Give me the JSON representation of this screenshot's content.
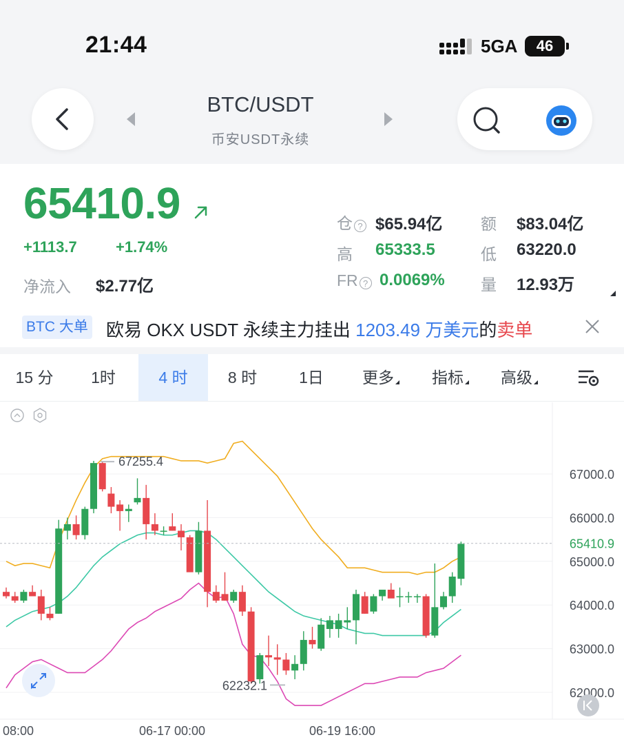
{
  "status_bar": {
    "time": "21:44",
    "network": "5GA",
    "battery": "46"
  },
  "header": {
    "pair": "BTC/USDT",
    "exchange": "币安USDT永续",
    "back_icon": "chevron-left-icon",
    "search_icon": "search-icon",
    "assistant_icon": "robot-avatar-icon"
  },
  "ticker": {
    "last_price": "65410.9",
    "change": "+1113.7",
    "change_pct": "+1.74%",
    "net_inflow_label": "净流入",
    "net_inflow_value": "$2.77亿",
    "stats": {
      "oi_label": "仓",
      "oi_value": "$65.94亿",
      "turnover_label": "额",
      "turnover_value": "$83.04亿",
      "high_label": "高",
      "high_value": "65333.5",
      "low_label": "低",
      "low_value": "63220.0",
      "fr_label": "FR",
      "fr_value": "0.0069%",
      "volume_label": "量",
      "volume_value": "12.93万"
    },
    "accent_green": "#2ea35a"
  },
  "news": {
    "tag": "BTC 大单",
    "text_prefix": "欧易 OKX USDT 永续主力挂出 ",
    "amount": "1203.49 万美元",
    "text_mid": "的",
    "side": "卖单"
  },
  "timeframes": [
    {
      "label": "15 分",
      "active": false,
      "dropdown": false
    },
    {
      "label": "1时",
      "active": false,
      "dropdown": false
    },
    {
      "label": "4 时",
      "active": true,
      "dropdown": false
    },
    {
      "label": "8 时",
      "active": false,
      "dropdown": false
    },
    {
      "label": "1日",
      "active": false,
      "dropdown": false
    },
    {
      "label": "更多",
      "active": false,
      "dropdown": true
    },
    {
      "label": "指标",
      "active": false,
      "dropdown": true
    },
    {
      "label": "高级",
      "active": false,
      "dropdown": true
    }
  ],
  "chart_data": {
    "type": "candlestick",
    "y_ticks": [
      67000,
      66000,
      65000,
      64000,
      63000,
      62000
    ],
    "y_tick_labels": [
      "67000.0",
      "66000.0",
      "65000.0",
      "64000.0",
      "63000.0",
      "62000.0"
    ],
    "ylim": [
      61600,
      67600
    ],
    "x_ticks": [
      "08:00",
      "06-17 00:00",
      "06-19 16:00"
    ],
    "current_price_label": "65410.9",
    "current_price": 65410.9,
    "max_label": "67255.4",
    "min_label": "62232.1",
    "up_color": "#2ea35a",
    "down_color": "#e7474d",
    "upper_band_color": "#f0ad1f",
    "mid_band_color": "#3cc8a5",
    "lower_band_color": "#dc48b4",
    "candles": [
      [
        64300,
        64400,
        64150,
        64200
      ],
      [
        64200,
        64300,
        64050,
        64100
      ],
      [
        64100,
        64350,
        64050,
        64300
      ],
      [
        64300,
        64450,
        64200,
        64200
      ],
      [
        64200,
        64350,
        63650,
        63800
      ],
      [
        63800,
        63950,
        63650,
        63700
      ],
      [
        63800,
        65950,
        63800,
        65750
      ],
      [
        65700,
        66000,
        65500,
        65850
      ],
      [
        65850,
        66050,
        65500,
        65600
      ],
      [
        65600,
        66250,
        65500,
        66200
      ],
      [
        66200,
        67300,
        66100,
        67250
      ],
      [
        67250,
        67300,
        66600,
        66650
      ],
      [
        66550,
        66700,
        66100,
        66250
      ],
      [
        66300,
        66400,
        65700,
        66150
      ],
      [
        66150,
        66300,
        65900,
        66200
      ],
      [
        66350,
        66900,
        66300,
        66450
      ],
      [
        66450,
        66750,
        65500,
        65850
      ],
      [
        65850,
        66100,
        65600,
        65700
      ],
      [
        65700,
        65800,
        65600,
        65700
      ],
      [
        65800,
        66100,
        65700,
        65700
      ],
      [
        65700,
        65850,
        65250,
        65550
      ],
      [
        65550,
        65600,
        64800,
        64750
      ],
      [
        64750,
        65900,
        64700,
        65700
      ],
      [
        65700,
        66400,
        63950,
        64300
      ],
      [
        64300,
        64450,
        64050,
        64100
      ],
      [
        64250,
        64750,
        64100,
        64100
      ],
      [
        64100,
        64350,
        64050,
        64300
      ],
      [
        64300,
        64450,
        63750,
        63850
      ],
      [
        63850,
        63950,
        62200,
        62250
      ],
      [
        62300,
        62900,
        62200,
        62850
      ],
      [
        62850,
        63300,
        62600,
        62800
      ],
      [
        62800,
        63100,
        62400,
        62750
      ],
      [
        62750,
        62900,
        62400,
        62500
      ],
      [
        62500,
        62850,
        62300,
        62650
      ],
      [
        62650,
        63400,
        62500,
        63200
      ],
      [
        63200,
        63500,
        63000,
        63100
      ],
      [
        63000,
        63700,
        62950,
        63550
      ],
      [
        63450,
        63750,
        63250,
        63650
      ],
      [
        63450,
        63800,
        63250,
        63650
      ],
      [
        63600,
        63950,
        63450,
        63650
      ],
      [
        63650,
        64350,
        63100,
        64250
      ],
      [
        64200,
        64300,
        63800,
        63800
      ],
      [
        63850,
        64250,
        63800,
        64200
      ],
      [
        64200,
        64350,
        64100,
        64350
      ],
      [
        64350,
        64500,
        64200,
        64150
      ],
      [
        64200,
        64400,
        63950,
        64200
      ],
      [
        64200,
        64300,
        64050,
        64200
      ],
      [
        64200,
        64250,
        64050,
        64200
      ],
      [
        64200,
        64250,
        63250,
        63300
      ],
      [
        63300,
        64950,
        63250,
        63950
      ],
      [
        63950,
        64300,
        63900,
        64200
      ],
      [
        64200,
        64750,
        64050,
        64650
      ],
      [
        64600,
        65450,
        64450,
        65400
      ]
    ],
    "upper_band": [
      [
        0,
        65000
      ],
      [
        1,
        64900
      ],
      [
        2,
        64950
      ],
      [
        3,
        64950
      ],
      [
        4,
        64900
      ],
      [
        5,
        64850
      ],
      [
        6,
        65450
      ],
      [
        7,
        65950
      ],
      [
        8,
        66400
      ],
      [
        9,
        66800
      ],
      [
        10,
        67150
      ],
      [
        11,
        67350
      ],
      [
        12,
        67400
      ],
      [
        13,
        67400
      ],
      [
        14,
        67400
      ],
      [
        15,
        67400
      ],
      [
        16,
        67400
      ],
      [
        17,
        67400
      ],
      [
        18,
        67400
      ],
      [
        19,
        67350
      ],
      [
        20,
        67300
      ],
      [
        21,
        67300
      ],
      [
        22,
        67300
      ],
      [
        23,
        67250
      ],
      [
        24,
        67300
      ],
      [
        25,
        67350
      ],
      [
        26,
        67700
      ],
      [
        27,
        67750
      ],
      [
        28,
        67550
      ],
      [
        29,
        67350
      ],
      [
        30,
        67150
      ],
      [
        31,
        66950
      ],
      [
        32,
        66650
      ],
      [
        33,
        66350
      ],
      [
        34,
        66050
      ],
      [
        35,
        65750
      ],
      [
        36,
        65500
      ],
      [
        37,
        65300
      ],
      [
        38,
        65100
      ],
      [
        39,
        64850
      ],
      [
        40,
        64850
      ],
      [
        41,
        64850
      ],
      [
        42,
        64800
      ],
      [
        43,
        64750
      ],
      [
        44,
        64750
      ],
      [
        45,
        64750
      ],
      [
        46,
        64750
      ],
      [
        47,
        64700
      ],
      [
        48,
        64750
      ],
      [
        49,
        64750
      ],
      [
        50,
        64850
      ],
      [
        51,
        65000
      ],
      [
        52,
        65100
      ]
    ],
    "mid_band": [
      [
        0,
        63500
      ],
      [
        1,
        63650
      ],
      [
        2,
        63750
      ],
      [
        3,
        63850
      ],
      [
        4,
        63900
      ],
      [
        5,
        63950
      ],
      [
        6,
        64050
      ],
      [
        7,
        64200
      ],
      [
        8,
        64400
      ],
      [
        9,
        64650
      ],
      [
        10,
        64900
      ],
      [
        11,
        65100
      ],
      [
        12,
        65250
      ],
      [
        13,
        65400
      ],
      [
        14,
        65500
      ],
      [
        15,
        65600
      ],
      [
        16,
        65650
      ],
      [
        17,
        65650
      ],
      [
        18,
        65600
      ],
      [
        19,
        65600
      ],
      [
        20,
        65650
      ],
      [
        21,
        65700
      ],
      [
        22,
        65700
      ],
      [
        23,
        65650
      ],
      [
        24,
        65500
      ],
      [
        25,
        65300
      ],
      [
        26,
        65100
      ],
      [
        27,
        64900
      ],
      [
        28,
        64700
      ],
      [
        29,
        64500
      ],
      [
        30,
        64300
      ],
      [
        31,
        64150
      ],
      [
        32,
        64000
      ],
      [
        33,
        63850
      ],
      [
        34,
        63750
      ],
      [
        35,
        63700
      ],
      [
        36,
        63650
      ],
      [
        37,
        63600
      ],
      [
        38,
        63550
      ],
      [
        39,
        63450
      ],
      [
        40,
        63400
      ],
      [
        41,
        63350
      ],
      [
        42,
        63350
      ],
      [
        43,
        63300
      ],
      [
        44,
        63300
      ],
      [
        45,
        63300
      ],
      [
        46,
        63300
      ],
      [
        47,
        63300
      ],
      [
        48,
        63300
      ],
      [
        49,
        63400
      ],
      [
        50,
        63600
      ],
      [
        51,
        63750
      ],
      [
        52,
        63900
      ]
    ],
    "lower_band": [
      [
        0,
        62100
      ],
      [
        1,
        62400
      ],
      [
        2,
        62550
      ],
      [
        3,
        62700
      ],
      [
        4,
        62750
      ],
      [
        5,
        62650
      ],
      [
        6,
        62550
      ],
      [
        7,
        62450
      ],
      [
        8,
        62450
      ],
      [
        9,
        62450
      ],
      [
        10,
        62600
      ],
      [
        11,
        62750
      ],
      [
        12,
        62950
      ],
      [
        13,
        63200
      ],
      [
        14,
        63450
      ],
      [
        15,
        63600
      ],
      [
        16,
        63700
      ],
      [
        17,
        63850
      ],
      [
        18,
        63950
      ],
      [
        19,
        64050
      ],
      [
        20,
        64150
      ],
      [
        21,
        64350
      ],
      [
        22,
        64500
      ],
      [
        23,
        64300
      ],
      [
        24,
        64150
      ],
      [
        25,
        64200
      ],
      [
        26,
        63800
      ],
      [
        27,
        63100
      ],
      [
        28,
        62850
      ],
      [
        29,
        62800
      ],
      [
        30,
        62550
      ],
      [
        31,
        62250
      ],
      [
        32,
        61850
      ],
      [
        33,
        61700
      ],
      [
        34,
        61700
      ],
      [
        35,
        61700
      ],
      [
        36,
        61700
      ],
      [
        37,
        61800
      ],
      [
        38,
        61900
      ],
      [
        39,
        62000
      ],
      [
        40,
        62100
      ],
      [
        41,
        62200
      ],
      [
        42,
        62200
      ],
      [
        43,
        62250
      ],
      [
        44,
        62300
      ],
      [
        45,
        62350
      ],
      [
        46,
        62350
      ],
      [
        47,
        62350
      ],
      [
        48,
        62450
      ],
      [
        49,
        62500
      ],
      [
        50,
        62550
      ],
      [
        51,
        62700
      ],
      [
        52,
        62850
      ]
    ]
  }
}
